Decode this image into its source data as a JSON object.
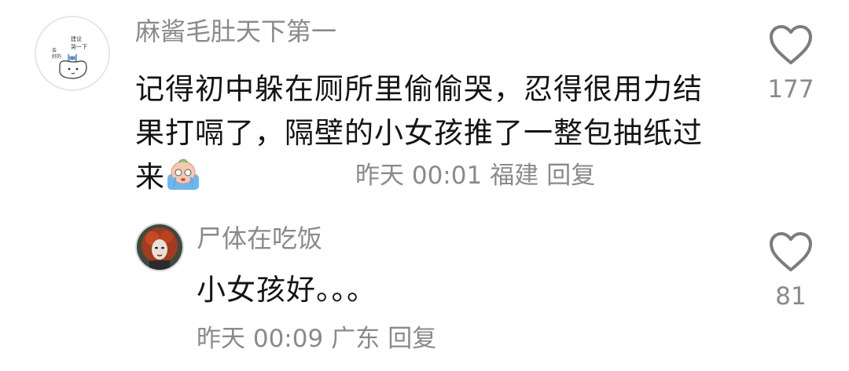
{
  "comments": [
    {
      "username": "麻酱毛肚天下第一",
      "text": "记得初中躲在厕所里偷偷哭，忍得很用力结果打嗝了，隔壁的小女孩推了一整包抽纸过来",
      "emoji": "crying-face-emoji",
      "time": "昨天 00:01",
      "location": "福建",
      "reply_label": "回复",
      "like_count": "177",
      "avatar_text": "建议哭一下会好的"
    },
    {
      "username": "尸体在吃饭",
      "text": "小女孩好。。。",
      "time": "昨天 00:09",
      "location": "广东",
      "reply_label": "回复",
      "like_count": "81"
    }
  ]
}
